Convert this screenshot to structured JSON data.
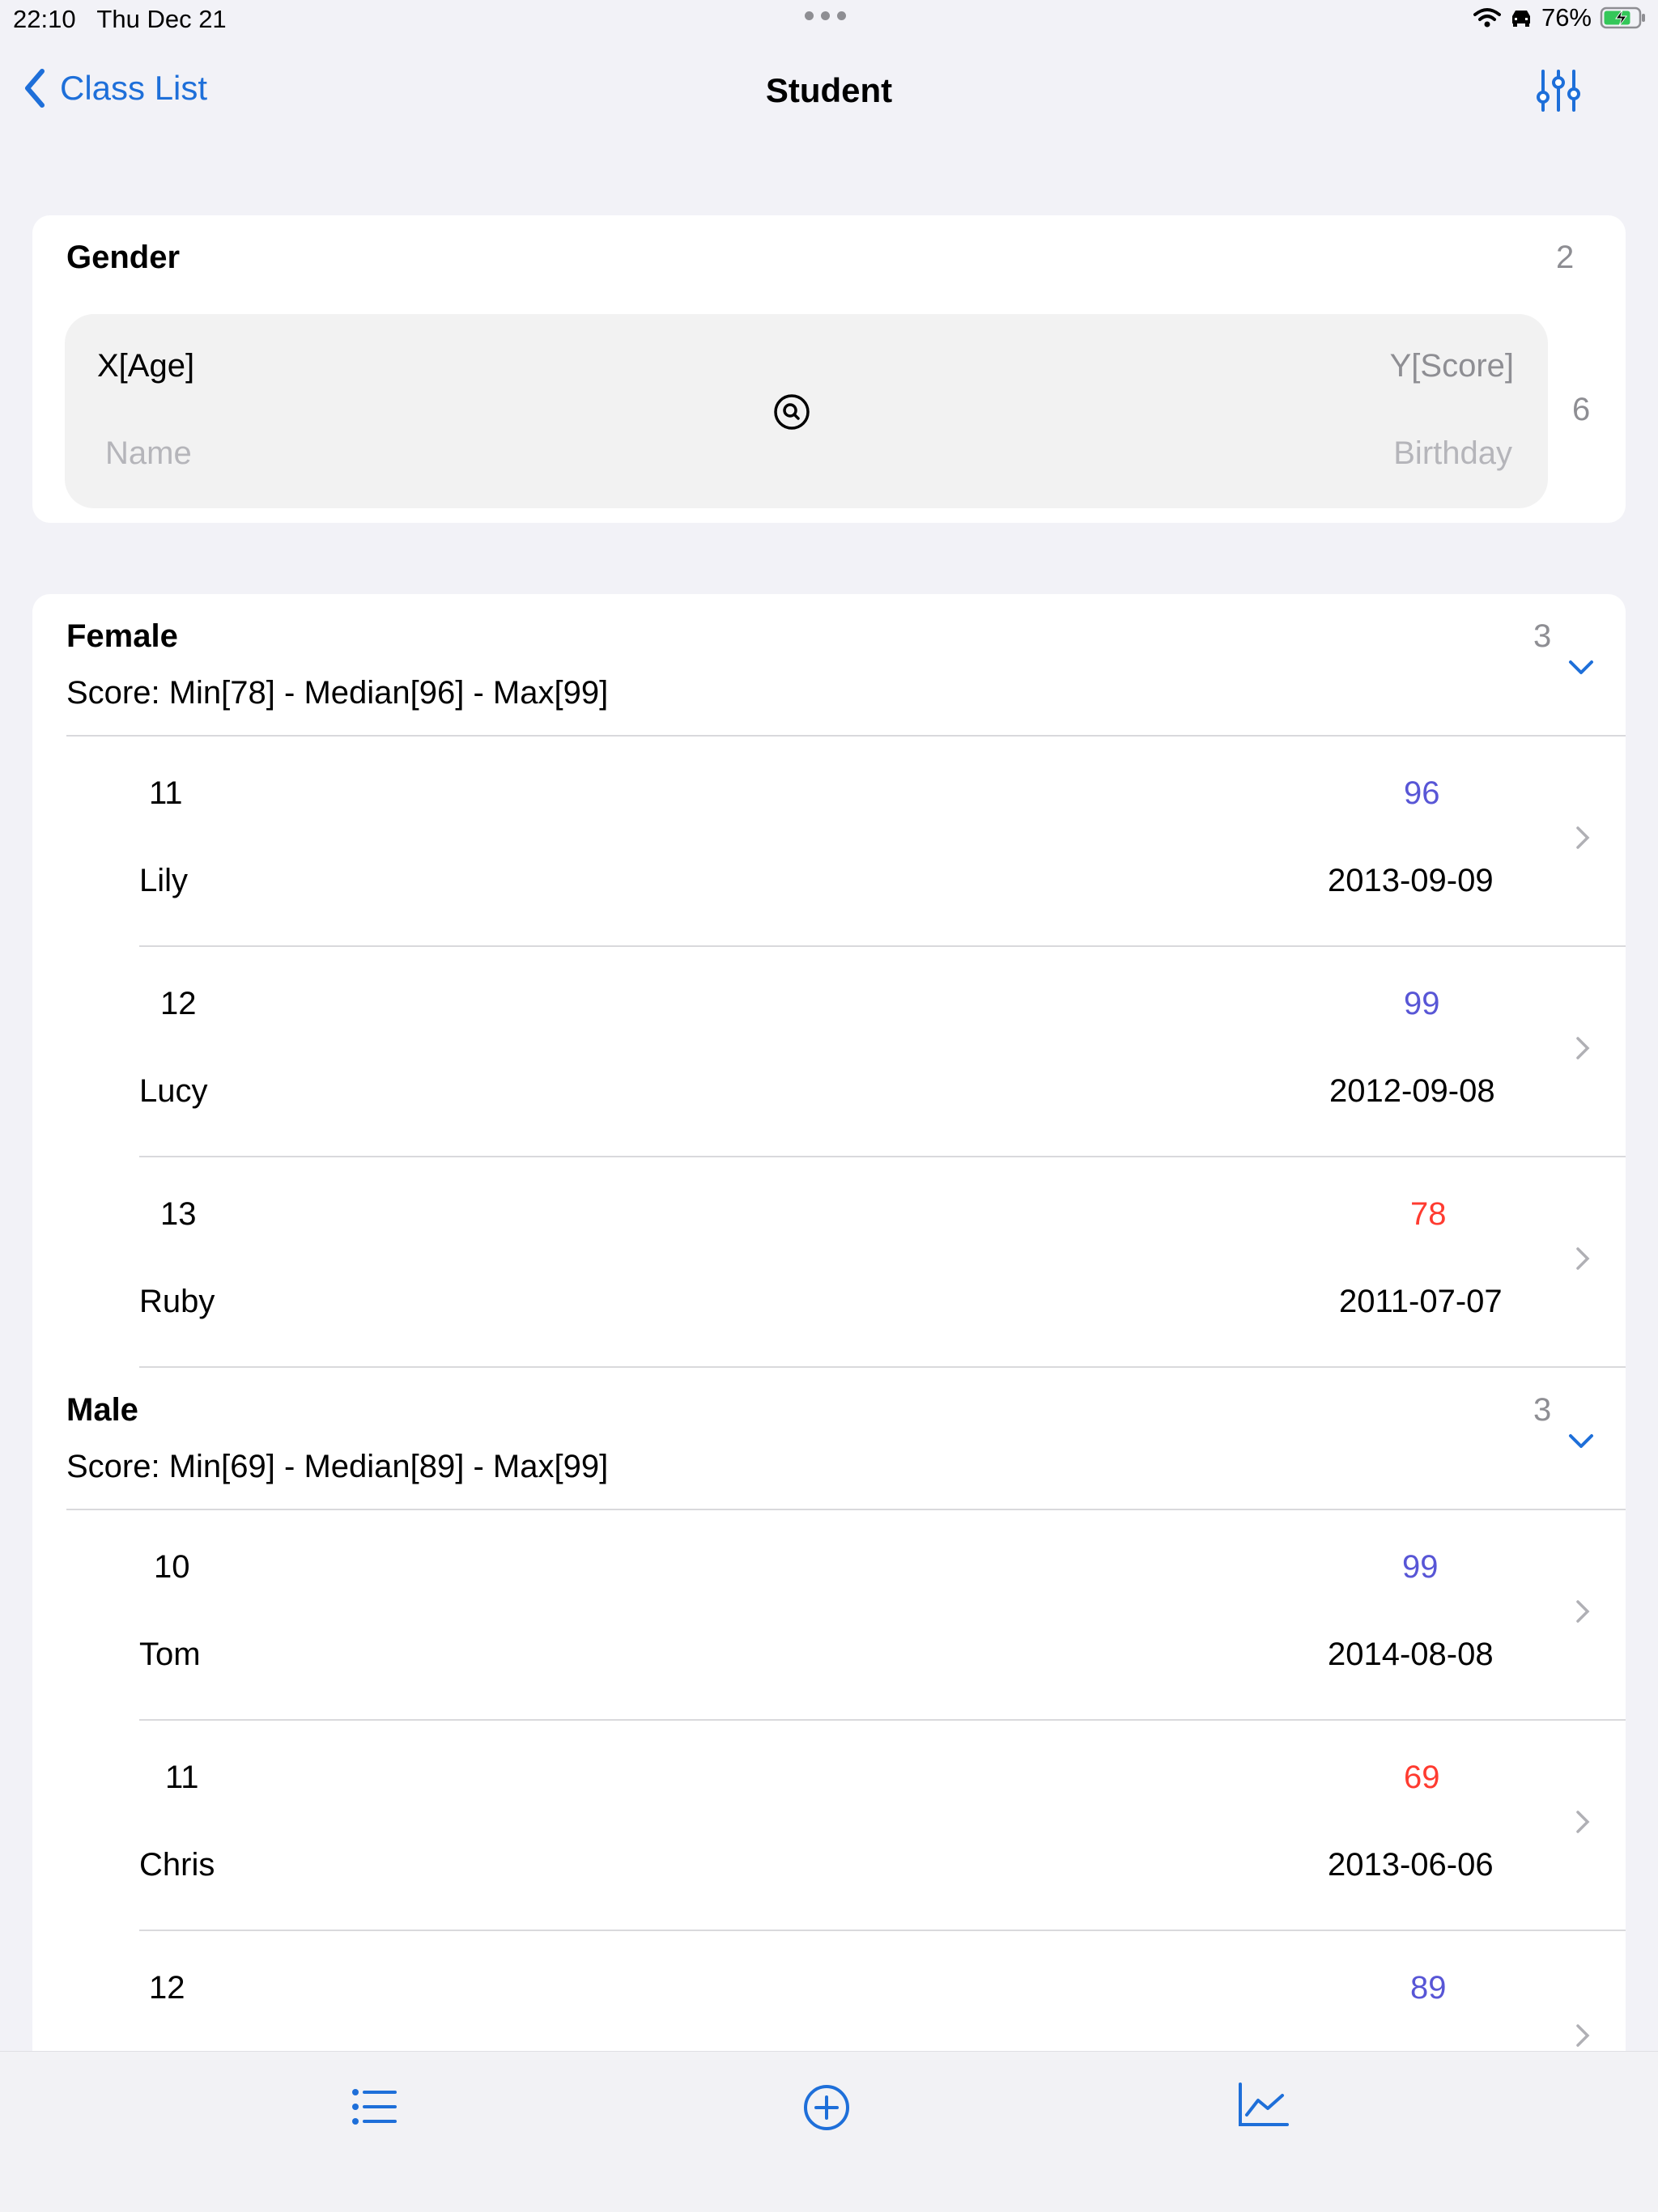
{
  "status_bar": {
    "time": "22:10",
    "date": "Thu Dec 21",
    "battery": "76%"
  },
  "nav": {
    "back_label": "Class List",
    "title": "Student"
  },
  "group_card": {
    "title": "Gender",
    "count": "2",
    "fields": {
      "x": "X[Age]",
      "y": "Y[Score]",
      "name": "Name",
      "birthday": "Birthday"
    },
    "field_count": "6"
  },
  "groups": [
    {
      "title": "Female",
      "count": "3",
      "summary": "Score: Min[78] - Median[96] - Max[99]",
      "rows": [
        {
          "age": "11",
          "name": "Lily",
          "score": "96",
          "birthday": "2013-09-09",
          "score_color": "blue"
        },
        {
          "age": "12",
          "name": "Lucy",
          "score": "99",
          "birthday": "2012-09-08",
          "score_color": "blue"
        },
        {
          "age": "13",
          "name": "Ruby",
          "score": "78",
          "birthday": "2011-07-07",
          "score_color": "red"
        }
      ]
    },
    {
      "title": "Male",
      "count": "3",
      "summary": "Score: Min[69] - Median[89] - Max[99]",
      "rows": [
        {
          "age": "10",
          "name": "Tom",
          "score": "99",
          "birthday": "2014-08-08",
          "score_color": "blue"
        },
        {
          "age": "11",
          "name": "Chris",
          "score": "69",
          "birthday": "2013-06-06",
          "score_color": "red"
        },
        {
          "age": "12",
          "name": "",
          "score": "89",
          "birthday": "",
          "score_color": "blue"
        }
      ]
    }
  ],
  "colors": {
    "accent": "#1e6fd9",
    "score_high": "#5856d6",
    "score_low": "#ff3b30"
  },
  "tabbar": {
    "items": [
      "list-icon",
      "add-circle-icon",
      "chart-icon"
    ]
  }
}
